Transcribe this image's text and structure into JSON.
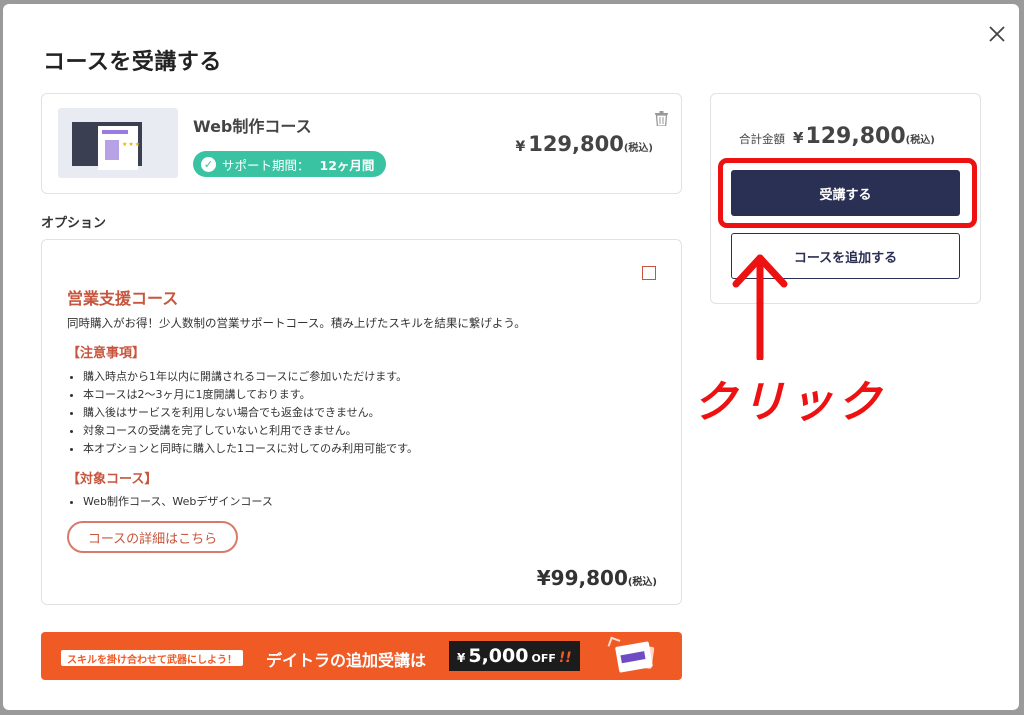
{
  "modal": {
    "title": "コースを受講する"
  },
  "course": {
    "name": "Web制作コース",
    "support_label": "サポート期間：",
    "support_value": "12ヶ月間",
    "price_symbol": "¥",
    "price": "129,800",
    "tax_note": "(税込)"
  },
  "options": {
    "heading": "オプション",
    "item": {
      "title": "営業支援コース",
      "description": "同時購入がお得！少人数制の営業サポートコース。積み上げたスキルを結果に繋げよう。",
      "notes_heading": "【注意事項】",
      "notes": [
        "購入時点から1年以内に開講されるコースにご参加いただけます。",
        "本コースは2〜3ヶ月に1度開講しております。",
        "購入後はサービスを利用しない場合でも返金はできません。",
        "対象コースの受講を完了していないと利用できません。",
        "本オプションと同時に購入した1コースに対してのみ利用可能です。"
      ],
      "target_heading": "【対象コース】",
      "targets": [
        "Web制作コース、Webデザインコース"
      ],
      "detail_button": "コースの詳細はこちら",
      "price": "¥99,800",
      "tax_note": "(税込)",
      "checked": false
    }
  },
  "banner": {
    "tag": "スキルを掛け合わせて武器にしよう！",
    "message": "デイトラの追加受講は",
    "discount_symbol": "¥",
    "discount_amount": "5,000",
    "discount_suffix": "OFF",
    "exclaim": "!!"
  },
  "summary": {
    "total_label": "合計金額",
    "total_symbol": "¥",
    "total_amount": "129,800",
    "tax_note": "(税込)",
    "enroll_button": "受講する",
    "add_course_button": "コースを追加する"
  },
  "annotation": {
    "click_text": "クリック"
  },
  "colors": {
    "accent_red": "#c8553d",
    "support_green": "#39c3a3",
    "primary_navy": "#2a2f54",
    "banner_orange": "#f05a25",
    "annotation_red": "#ee1111"
  },
  "icons": [
    "close-icon",
    "trash-icon",
    "check-circle-icon",
    "arrow-up-icon"
  ]
}
